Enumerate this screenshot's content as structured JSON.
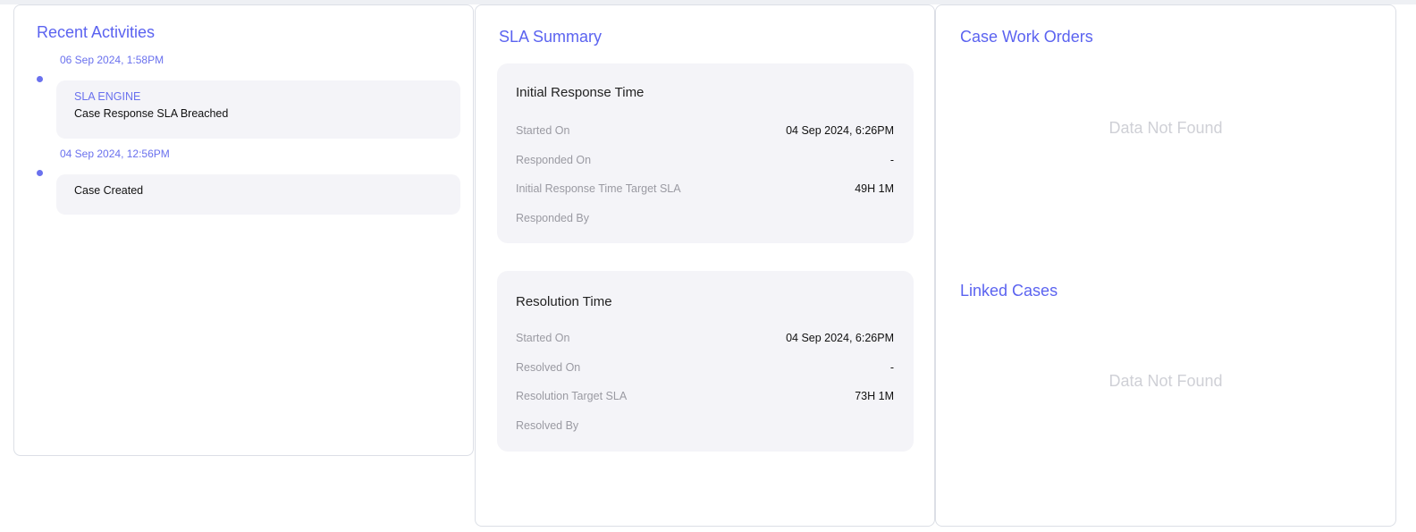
{
  "recent_activities": {
    "title": "Recent Activities",
    "items": [
      {
        "date": "06 Sep 2024, 1:58PM",
        "source": "SLA ENGINE",
        "text": "Case Response SLA Breached"
      },
      {
        "date": "04 Sep 2024, 12:56PM",
        "text": "Case Created"
      }
    ]
  },
  "sla_summary": {
    "title": "SLA Summary",
    "initial_response": {
      "title": "Initial Response Time",
      "rows": [
        {
          "label": "Started On",
          "value": "04 Sep 2024, 6:26PM"
        },
        {
          "label": "Responded On",
          "value": "-"
        },
        {
          "label": "Initial Response Time Target SLA",
          "value": "49H 1M"
        },
        {
          "label": "Responded By",
          "value": ""
        }
      ]
    },
    "resolution": {
      "title": "Resolution Time",
      "rows": [
        {
          "label": "Started On",
          "value": "04 Sep 2024, 6:26PM"
        },
        {
          "label": "Resolved On",
          "value": "-"
        },
        {
          "label": "Resolution Target SLA",
          "value": "73H 1M"
        },
        {
          "label": "Resolved By",
          "value": ""
        }
      ]
    }
  },
  "case_work_orders": {
    "title": "Case Work Orders",
    "empty_text": "Data Not Found"
  },
  "linked_cases": {
    "title": "Linked Cases",
    "empty_text": "Data Not Found"
  },
  "colors": {
    "accent": "#5b63f0",
    "card_bg": "#f4f4f8",
    "muted": "#9a9aa2"
  }
}
